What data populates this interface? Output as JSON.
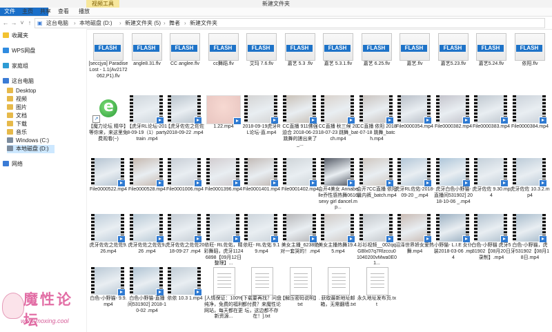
{
  "window": {
    "title": "新建文件夹",
    "context_tab": "视频工具"
  },
  "ribbon": {
    "tabs": [
      "文件",
      "主页",
      "共享",
      "查看",
      "播放"
    ]
  },
  "address": {
    "crumbs": [
      "这台电脑",
      "本地磁盘 (D:)",
      "新建文件夹 (5)",
      "舞者",
      "新建文件夹"
    ]
  },
  "sidebar": {
    "items": [
      {
        "label": "收藏夹",
        "icon": "star-icon",
        "color": "#f2c230"
      },
      {
        "label": "WPS网盘",
        "icon": "cloud-icon",
        "color": "#2f8be0"
      },
      {
        "label": "家庭组",
        "icon": "homegroup-icon",
        "color": "#2d9bd4"
      },
      {
        "label": "这台电脑",
        "icon": "computer-icon",
        "color": "#3a7bd5"
      },
      {
        "label": "Desktop",
        "icon": "folder-icon",
        "color": "#e6b94a"
      },
      {
        "label": "视频",
        "icon": "folder-icon",
        "color": "#e6b94a"
      },
      {
        "label": "图片",
        "icon": "folder-icon",
        "color": "#e6b94a"
      },
      {
        "label": "文档",
        "icon": "folder-icon",
        "color": "#e6b94a"
      },
      {
        "label": "下载",
        "icon": "folder-icon",
        "color": "#e6b94a"
      },
      {
        "label": "音乐",
        "icon": "folder-icon",
        "color": "#e6b94a"
      },
      {
        "label": "Windows (C:)",
        "icon": "drive-icon",
        "color": "#7c8c9e"
      },
      {
        "label": "本地磁盘 (D:)",
        "icon": "drive-icon",
        "color": "#7c8c9e",
        "selected": true
      },
      {
        "label": "网络",
        "icon": "network-icon",
        "color": "#3a7bd5"
      }
    ]
  },
  "files": [
    {
      "name": "[seccjya] Paradise Lost - 1.1(Av2172062,P1).flv",
      "kind": "flash"
    },
    {
      "name": "angle8.31.flv",
      "kind": "flash"
    },
    {
      "name": "CC anglee.flv",
      "kind": "flash"
    },
    {
      "name": "cc舞蹈.flv",
      "kind": "flash"
    },
    {
      "name": "艾玛 7.6.flv",
      "kind": "flash"
    },
    {
      "name": "嘉艺 5.3 .flv",
      "kind": "flash"
    },
    {
      "name": "嘉艺 5.3.1.flv",
      "kind": "flash"
    },
    {
      "name": "嘉艺 6.25.flv",
      "kind": "flash"
    },
    {
      "name": "嘉艺.flv",
      "kind": "flash"
    },
    {
      "name": "嘉艺5.23.flv",
      "kind": "flash"
    },
    {
      "name": "嘉艺5.24.flv",
      "kind": "flash"
    },
    {
      "name": "依阳.flv",
      "kind": "flash"
    },
    {
      "name": "【魔力论坛 精华】等你来，来这里免费观看(~)",
      "kind": "ie"
    },
    {
      "name": "【虎牙RL论坛-2018-09-19（1）party train .mp4",
      "kind": "video",
      "tone": "#cfd6dc"
    },
    {
      "name": "【虎牙佐佐之佐佐2018-09-22 .mp4",
      "kind": "video",
      "tone": "#b9c3cc"
    },
    {
      "name": "1.22.mp4",
      "kind": "photo",
      "tone": "#e8c5c0"
    },
    {
      "name": "2018-09-19虎牙RL论坛-直.mp4",
      "kind": "video",
      "tone": "#d4d4d4"
    },
    {
      "name": "CC直播 911佛强迫合 2018-06-23 跳舞的搓出来了_...",
      "kind": "video",
      "tone": "#c9c1b8"
    },
    {
      "name": "CC直播 秋三候 2018-07-23 跳舞_batch.mp4",
      "kind": "video",
      "tone": "#d9d2cc"
    },
    {
      "name": "CC直播 依阳 2018-07-18 跳舞_batch.mp4",
      "kind": "video",
      "tone": "#cac4c0"
    },
    {
      "name": "File0000354.mp4",
      "kind": "video",
      "tone": "#b9bfc8"
    },
    {
      "name": "File0000382.mp4",
      "kind": "video",
      "tone": "#c4c4cc"
    },
    {
      "name": "File0000383.mp4",
      "kind": "video",
      "tone": "#c0c8d0"
    },
    {
      "name": "File0000384.mp4",
      "kind": "video",
      "tone": "#cbd2da"
    },
    {
      "name": "File0000522.mp4",
      "kind": "video",
      "tone": "#b5c4d2"
    },
    {
      "name": "File0000528.mp4",
      "kind": "video",
      "tone": "#c6b9b0"
    },
    {
      "name": "File0001006.mp4",
      "kind": "video",
      "tone": "#c8ced6"
    },
    {
      "name": "File0001396.mp4",
      "kind": "video",
      "tone": "#d2cdd0"
    },
    {
      "name": "File0001401.mp4",
      "kind": "video",
      "tone": "#c2bab6"
    },
    {
      "name": "File0001402.mp4",
      "kind": "video",
      "tone": "#cfd5d9"
    },
    {
      "name": "会开4美女 Annabelle乔性感热舞0616 sexy girl dancel.mp...",
      "kind": "video",
      "tone": "#555b66"
    },
    {
      "name": "会开7CC直播 依阳 曩内裤_batch.mp4",
      "kind": "video",
      "tone": "#cfc7c0"
    },
    {
      "name": "虎牙RL佐佑-2018-09-20 _.mp4",
      "kind": "video",
      "tone": "#b3c7d8"
    },
    {
      "name": "虎牙白色小野猫-直播间531902] 2018-10-06 _.mp4",
      "kind": "video",
      "tone": "#aec6d9"
    },
    {
      "name": "虎牙佐佐 9.30.mp4",
      "kind": "video",
      "tone": "#c4d0da"
    },
    {
      "name": "虎牙佐佐 10.3.2.mp4",
      "kind": "video",
      "tone": "#bccbd8"
    },
    {
      "name": "虎牙佐佐之佐佐9.26.mp4",
      "kind": "video",
      "tone": "#bfcedb"
    },
    {
      "name": "虎牙佐佐之佐佐9.26 .mp4",
      "kind": "video",
      "tone": "#b7c9d6"
    },
    {
      "name": "虎牙佐佐之佐佐2018-09-27 .mp4",
      "kind": "video",
      "tone": "#c6ced6"
    },
    {
      "name": "依旺- RL佐佑，精彩舞蹈，虎牙11246898【09月12日整理】...",
      "kind": "video",
      "tone": "#c9d2da"
    },
    {
      "name": "依旺- RL佐佑 9.19.mp4",
      "kind": "video",
      "tone": "#cdd5dc"
    },
    {
      "name": "美女主播_6238绝对一套哭的！.mp4",
      "kind": "video",
      "tone": "#b7b7b9"
    },
    {
      "name": "美女主播热舞19.4.5.mp4",
      "kind": "video",
      "tone": "#d0cac6"
    },
    {
      "name": "衫衫视频__002qqGBlx07q7Rlzccu01040200vMwa0E01...",
      "kind": "video",
      "tone": "#c3c7cb"
    },
    {
      "name": "沼泽世界娇女爱热舞.mp4",
      "kind": "video",
      "tone": "#c9bbb4"
    },
    {
      "name": "小野猫- L.I.E 女仆装2018-03-06 .mp4",
      "kind": "video",
      "tone": "#9bb0c2"
    },
    {
      "name": "白色-小野猫 虎牙531902【08月20日录制】.mp4",
      "kind": "video",
      "tone": "#b2c2d0"
    },
    {
      "name": "白色-小野猫，虎牙531902【08月18日.mp4",
      "kind": "video",
      "tone": "#a8bccc"
    },
    {
      "name": "白色-小野猫- 9.9.mp4",
      "kind": "video",
      "tone": "#bac9d6"
    },
    {
      "name": "白色小野猫-直播间531902] 2018-10-02 .mp4",
      "kind": "video",
      "tone": "#b0c4d4"
    },
    {
      "name": "依依 10.3 1.mp4",
      "kind": "video",
      "tone": "#c0ccd6"
    },
    {
      "name": "[人情保证：100%纯净，免费的福利网站，每天都在更新资源...",
      "kind": "txt"
    },
    {
      "name": "[下载要再找？问盘都付费？来魔性论坛，这边都不存在！].txt",
      "kind": "txt"
    },
    {
      "name": "【解压密码说明】.txt",
      "kind": "txt"
    },
    {
      "name": "获取最新地址邮箱，无需翻墙.txt",
      "kind": "txt"
    },
    {
      "name": "永久地址发布页.txt",
      "kind": "txt"
    }
  ],
  "watermark": {
    "title": "魔性论坛",
    "url": "www.moxing.cool"
  }
}
